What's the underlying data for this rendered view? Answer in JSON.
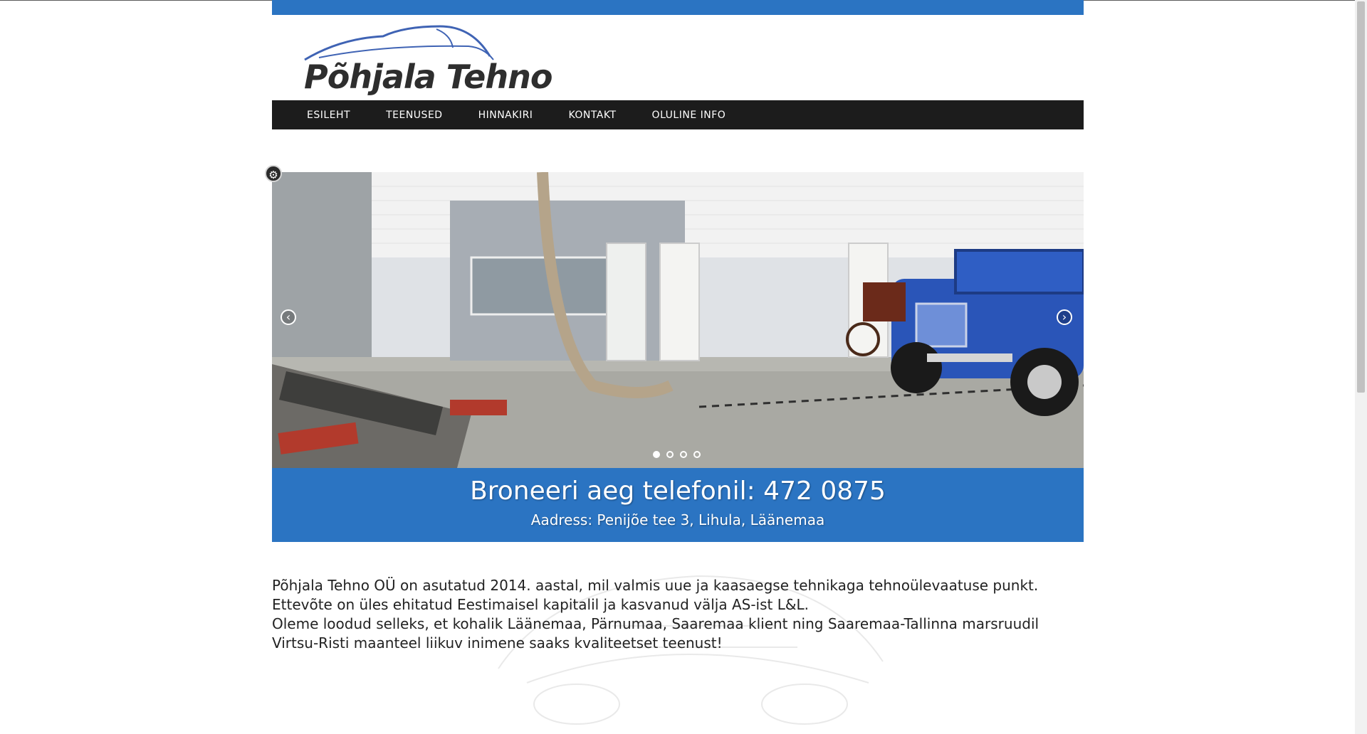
{
  "brand": {
    "logo_text": "Põhjala Tehno"
  },
  "nav": {
    "items": [
      {
        "label": "ESILEHT"
      },
      {
        "label": "TEENUSED"
      },
      {
        "label": "HINNAKIRI"
      },
      {
        "label": "KONTAKT"
      },
      {
        "label": "OLULINE INFO"
      }
    ]
  },
  "slider": {
    "prev_icon": "chevron-left-icon",
    "next_icon": "chevron-right-icon",
    "settings_icon": "gear-icon",
    "slide_count": 4,
    "active_slide": 1
  },
  "banner": {
    "title": "Broneeri aeg telefonil: 472 0875",
    "address": "Aadress: Penijõe tee 3, Lihula, Läänemaa"
  },
  "content": {
    "paragraph1": "Põhjala Tehno OÜ on asutatud 2014. aastal, mil valmis uue ja kaasaegse tehnikaga tehnoülevaatuse punkt. Ettevõte on üles ehitatud Eestimaisel kapitalil ja kasvanud välja AS-ist L&L.",
    "paragraph2": "Oleme loodud selleks, et kohalik Läänemaa, Pärnumaa, Saaremaa klient ning Saaremaa-Tallinna marsruudil Virtsu-Risti maanteel liikuv inimene saaks kvaliteetset teenust!"
  },
  "colors": {
    "accent": "#2b74c2",
    "nav_bg": "#1c1c1c"
  }
}
